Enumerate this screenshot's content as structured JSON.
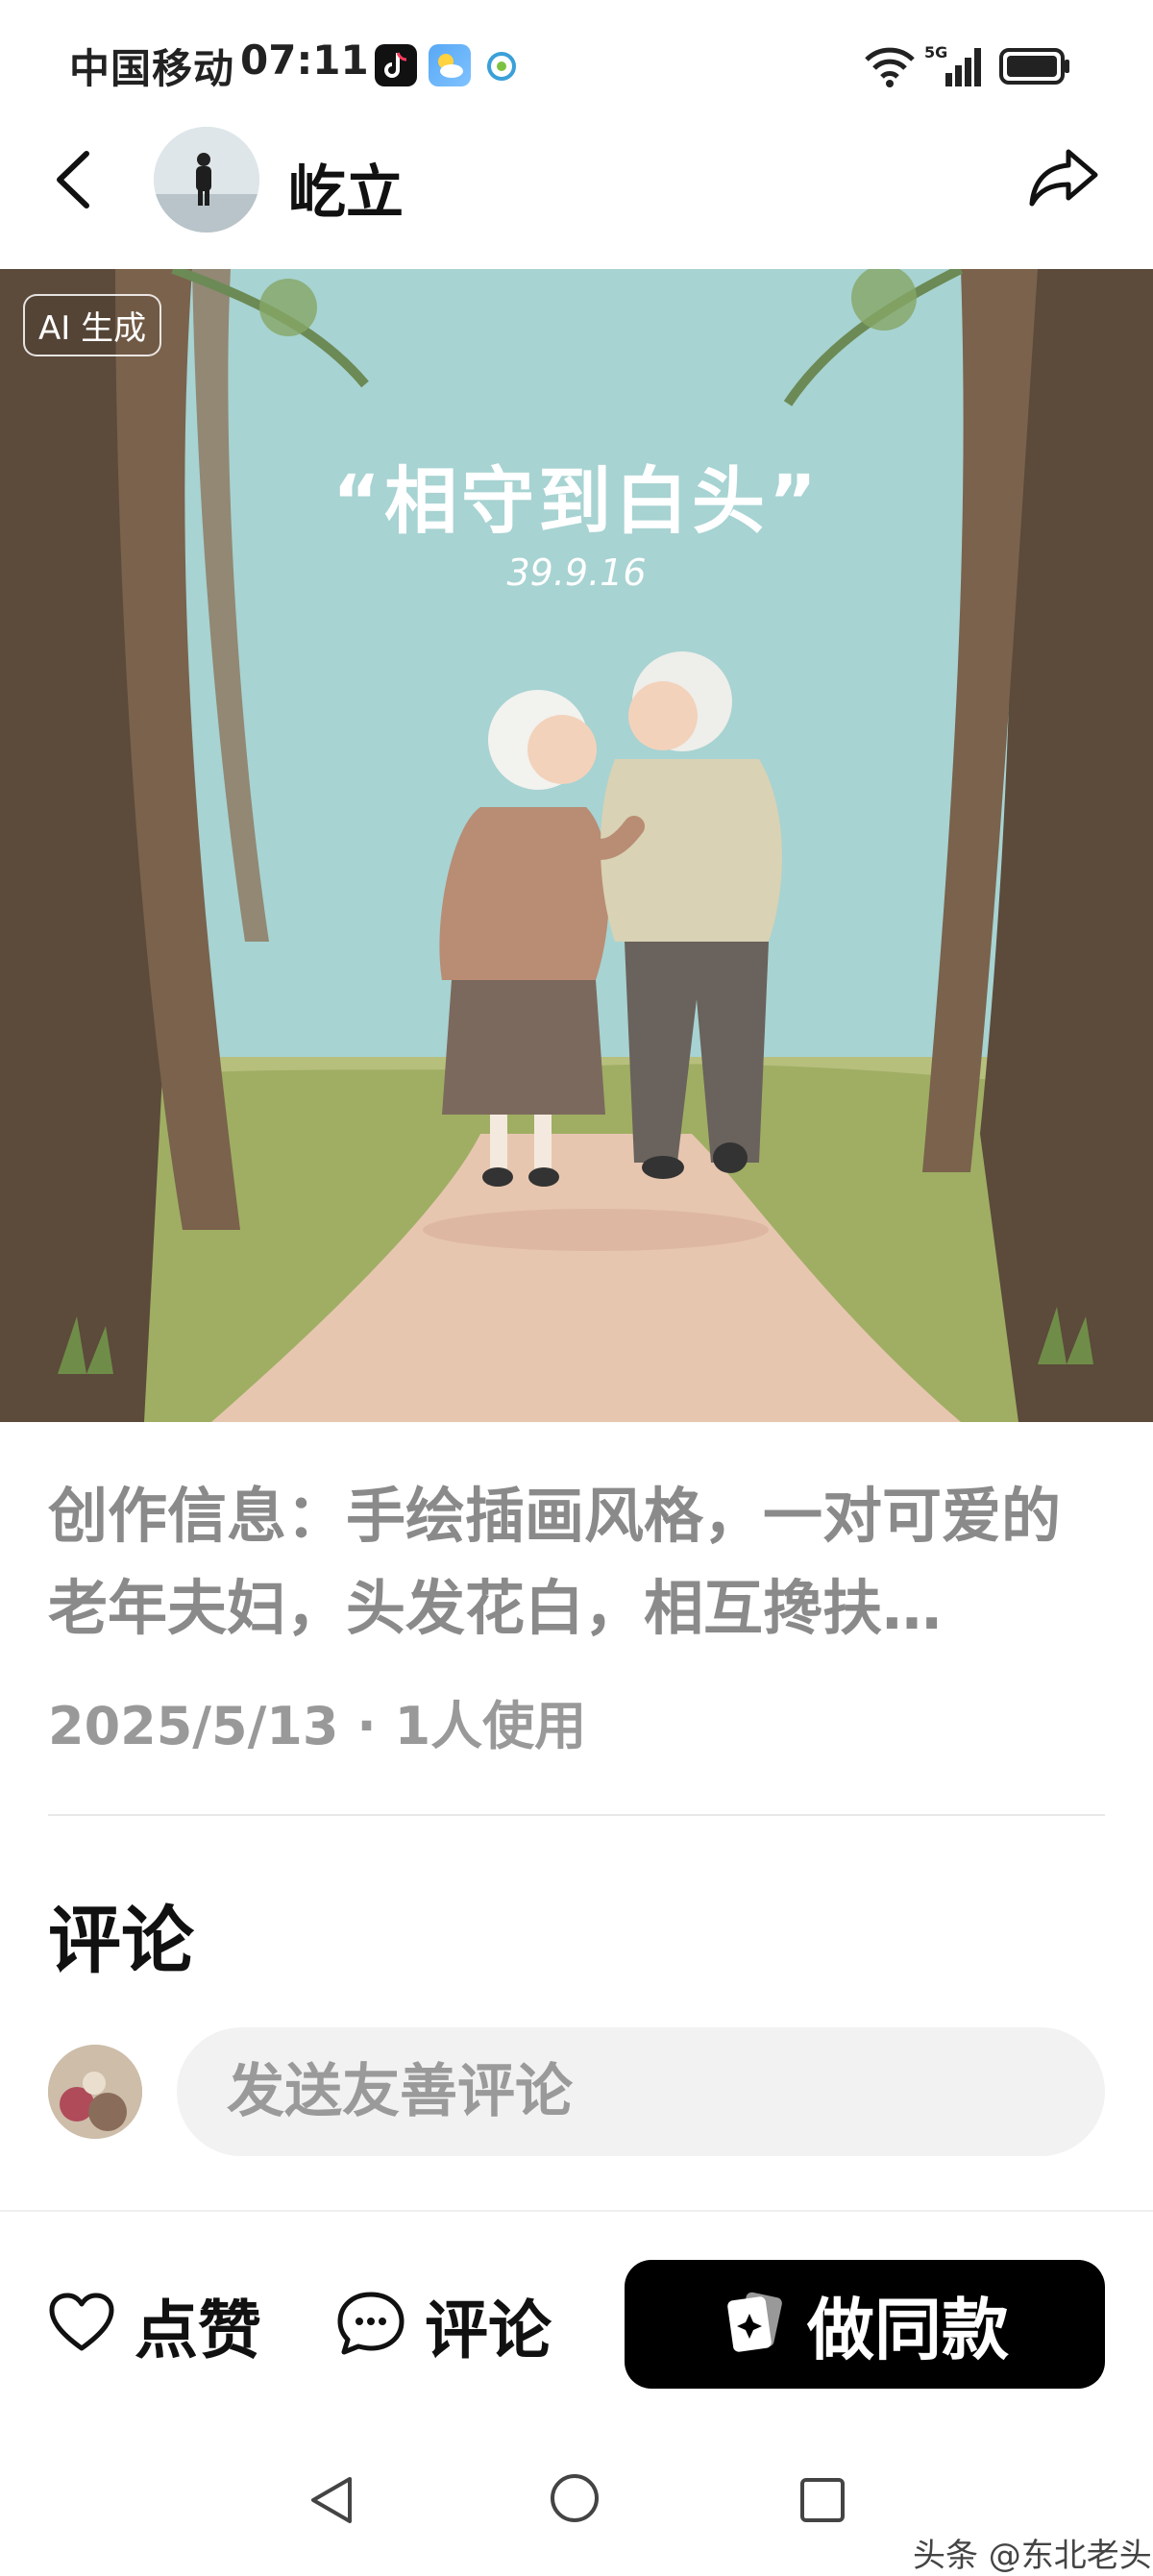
{
  "status_bar": {
    "carrier": "中国移动",
    "time": "07:11"
  },
  "header": {
    "author_name": "屹立"
  },
  "artwork": {
    "badge": "AI 生成",
    "title": "“相守到白头”",
    "subtitle": "39.9.16"
  },
  "post": {
    "description": "创作信息：手绘插画风格，一对可爱的老年夫妇，头发花白，相互搀扶…",
    "meta": "2025/5/13 · 1人使用"
  },
  "comments": {
    "heading": "评论",
    "input_placeholder": "发送友善评论"
  },
  "actions": {
    "like_label": "点赞",
    "comment_label": "评论",
    "make_same_label": "做同款"
  },
  "watermark": "头条 @东北老头",
  "colors": {
    "sky": "#a7d3d2",
    "path": "#e7c6b0",
    "button": "#000000"
  }
}
